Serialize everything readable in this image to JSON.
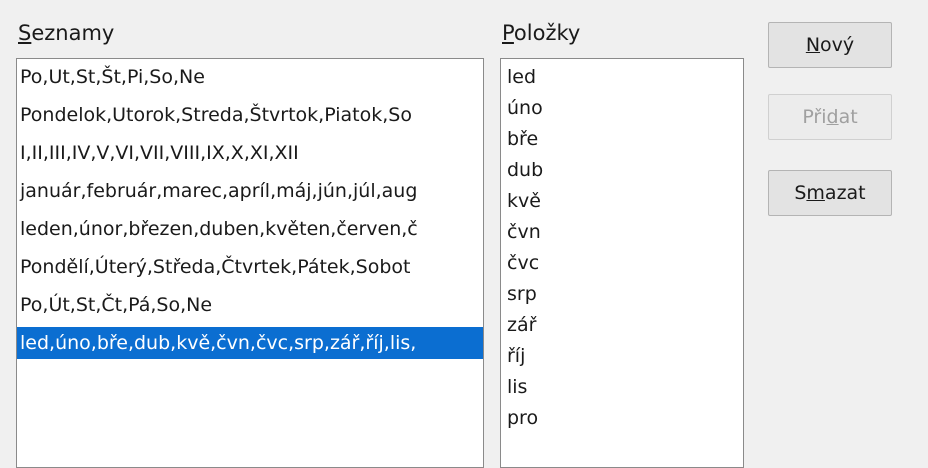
{
  "labels": {
    "lists_prefix": "S",
    "lists_rest": "eznamy",
    "items_prefix": "P",
    "items_rest": "oložky"
  },
  "buttons": {
    "new_pre": "",
    "new_acc": "N",
    "new_post": "ový",
    "add_pre": "Při",
    "add_acc": "d",
    "add_post": "at",
    "delete_pre": "S",
    "delete_acc": "m",
    "delete_post": "azat"
  },
  "lists": [
    "Po,Ut,St,Št,Pi,So,Ne",
    "Pondelok,Utorok,Streda,Štvrtok,Piatok,So",
    "I,II,III,IV,V,VI,VII,VIII,IX,X,XI,XII",
    "január,február,marec,apríl,máj,jún,júl,aug",
    "leden,únor,březen,duben,květen,červen,č",
    "Pondělí,Úterý,Středa,Čtvrtek,Pátek,Sobot",
    "Po,Út,St,Čt,Pá,So,Ne",
    "led,úno,bře,dub,kvě,čvn,čvc,srp,zář,říj,lis,"
  ],
  "selected_list_index": 7,
  "items": [
    "led",
    "úno",
    "bře",
    "dub",
    "kvě",
    "čvn",
    "čvc",
    "srp",
    "zář",
    "říj",
    "lis",
    "pro"
  ],
  "colors": {
    "selection": "#0b6ed1"
  }
}
